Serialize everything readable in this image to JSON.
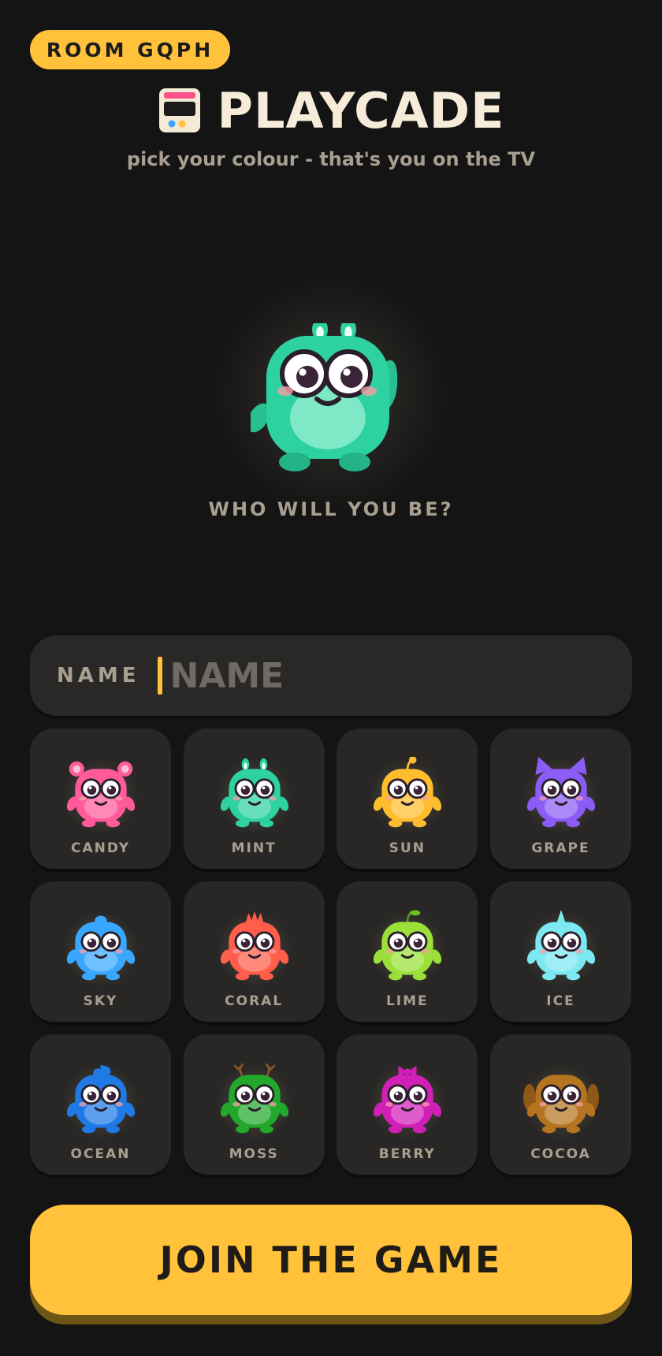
{
  "room": {
    "label": "ROOM GQPH"
  },
  "header": {
    "app_name": "PLAYCADE",
    "logo_icon": "arcade-cabinet-icon"
  },
  "tagline": "pick your colour - that's you on the TV",
  "hero": {
    "prompt": "WHO WILL YOU BE?",
    "selected": "MINT"
  },
  "name_field": {
    "label": "NAME",
    "placeholder": "NAME",
    "value": ""
  },
  "colors": [
    {
      "label": "CANDY",
      "hex": "#ff5b9a",
      "feature": "bear-ears"
    },
    {
      "label": "MINT",
      "hex": "#2ed1a0",
      "feature": "bunny-ears"
    },
    {
      "label": "SUN",
      "hex": "#ffbd2e",
      "feature": "antenna"
    },
    {
      "label": "GRAPE",
      "hex": "#8b5cf6",
      "feature": "cat-ears"
    },
    {
      "label": "SKY",
      "hex": "#3aa7ff",
      "feature": "tuft"
    },
    {
      "label": "CORAL",
      "hex": "#ff5e4a",
      "feature": "crest"
    },
    {
      "label": "LIME",
      "hex": "#9be03a",
      "feature": "sprout"
    },
    {
      "label": "ICE",
      "hex": "#7be8f2",
      "feature": "horn"
    },
    {
      "label": "OCEAN",
      "hex": "#1f7ae6",
      "feature": "curl"
    },
    {
      "label": "MOSS",
      "hex": "#22a92b",
      "feature": "antlers"
    },
    {
      "label": "BERRY",
      "hex": "#d21fb8",
      "feature": "bow"
    },
    {
      "label": "COCOA",
      "hex": "#b57520",
      "feature": "floppy-ears"
    }
  ],
  "join_button": {
    "label": "JOIN THE GAME"
  },
  "theme": {
    "accent": "#ffc23a",
    "background": "#141414",
    "card": "#292725"
  }
}
